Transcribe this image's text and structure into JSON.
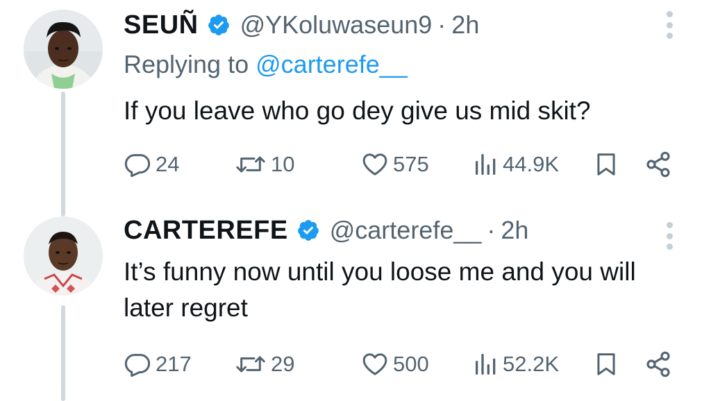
{
  "tweets": [
    {
      "display_name": "SEUÑ",
      "handle": "@YKoluwaseun9",
      "separator": "·",
      "time": "2h",
      "replying_prefix": "Replying to",
      "replying_to": "@carterefe__",
      "text": "If you leave who go dey give us mid skit?",
      "replies": "24",
      "retweets": "10",
      "likes": "575",
      "views": "44.9K"
    },
    {
      "display_name": "CARTEREFE",
      "handle": "@carterefe__",
      "separator": "·",
      "time": "2h",
      "text": "It’s funny now until you loose me and you will later regret",
      "replies": "217",
      "retweets": "29",
      "likes": "500",
      "views": "52.2K"
    }
  ],
  "icons": {
    "verified": "verified-badge-icon",
    "reply": "reply-icon",
    "retweet": "retweet-icon",
    "like": "heart-icon",
    "views": "views-icon",
    "bookmark": "bookmark-icon",
    "share": "share-icon",
    "more": "more-vertical-icon"
  },
  "colors": {
    "verified": "#1d9bf0",
    "mention": "#1d9bf0",
    "secondary_text": "#536471",
    "thread_line": "#cfd9de"
  }
}
